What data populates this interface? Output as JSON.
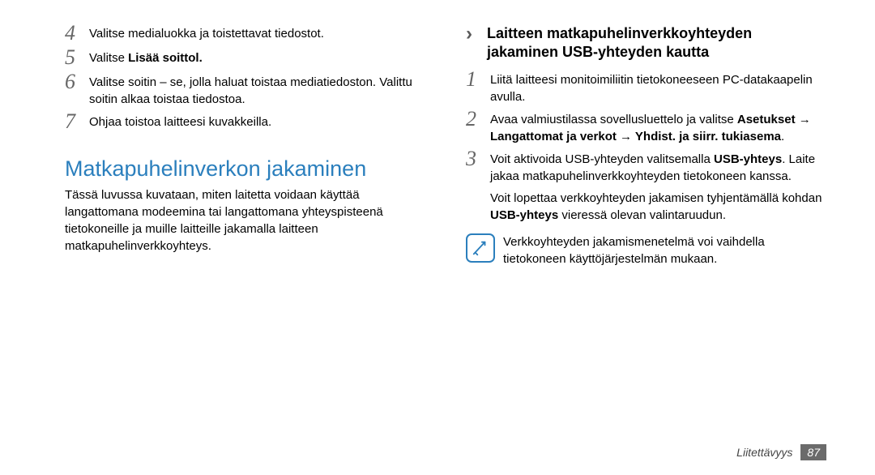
{
  "left": {
    "steps": [
      {
        "num": "4",
        "text": "Valitse medialuokka ja toistettavat tiedostot."
      },
      {
        "num": "5",
        "text": "Valitse ",
        "bold_tail": "Lisää soittol."
      },
      {
        "num": "6",
        "text": "Valitse soitin – se, jolla haluat toistaa mediatiedoston. Valittu soitin alkaa toistaa tiedostoa."
      },
      {
        "num": "7",
        "text": "Ohjaa toistoa laitteesi kuvakkeilla."
      }
    ],
    "section_title": "Matkapuhelinverkon jakaminen",
    "section_para": "Tässä luvussa kuvataan, miten laitetta voidaan käyttää langattomana modeemina tai langattomana yhteyspisteenä tietokoneille ja muille laitteille jakamalla laitteen matkapuhelinverkkoyhteys."
  },
  "right": {
    "chevron": "›",
    "subhead": "Laitteen matkapuhelinverkkoyhteyden jakaminen USB-yhteyden kautta",
    "steps": [
      {
        "num": "1",
        "text": "Liitä laitteesi monitoimiliitin tietokoneeseen PC-datakaapelin avulla."
      },
      {
        "num": "2",
        "parts": [
          {
            "t": "Avaa valmiustilassa sovellusluettelo ja valitse "
          },
          {
            "t": "Asetukset → Langattomat ja verkot → Yhdist. ja siirr. tukiasema",
            "b": true
          },
          {
            "t": "."
          }
        ]
      },
      {
        "num": "3",
        "parts": [
          {
            "t": "Voit aktivoida USB-yhteyden valitsemalla "
          },
          {
            "t": "USB-yhteys",
            "b": true
          },
          {
            "t": ". Laite jakaa matkapuhelinverkkoyhteyden tietokoneen kanssa."
          }
        ],
        "extra_parts": [
          {
            "t": "Voit lopettaa verkkoyhteyden jakamisen tyhjentämällä kohdan "
          },
          {
            "t": "USB-yhteys",
            "b": true
          },
          {
            "t": " vieressä olevan valintaruudun."
          }
        ]
      }
    ],
    "note": "Verkkoyhteyden jakamismenetelmä voi vaihdella tietokoneen käyttöjärjestelmän mukaan."
  },
  "footer": {
    "section": "Liitettävyys",
    "page": "87"
  }
}
